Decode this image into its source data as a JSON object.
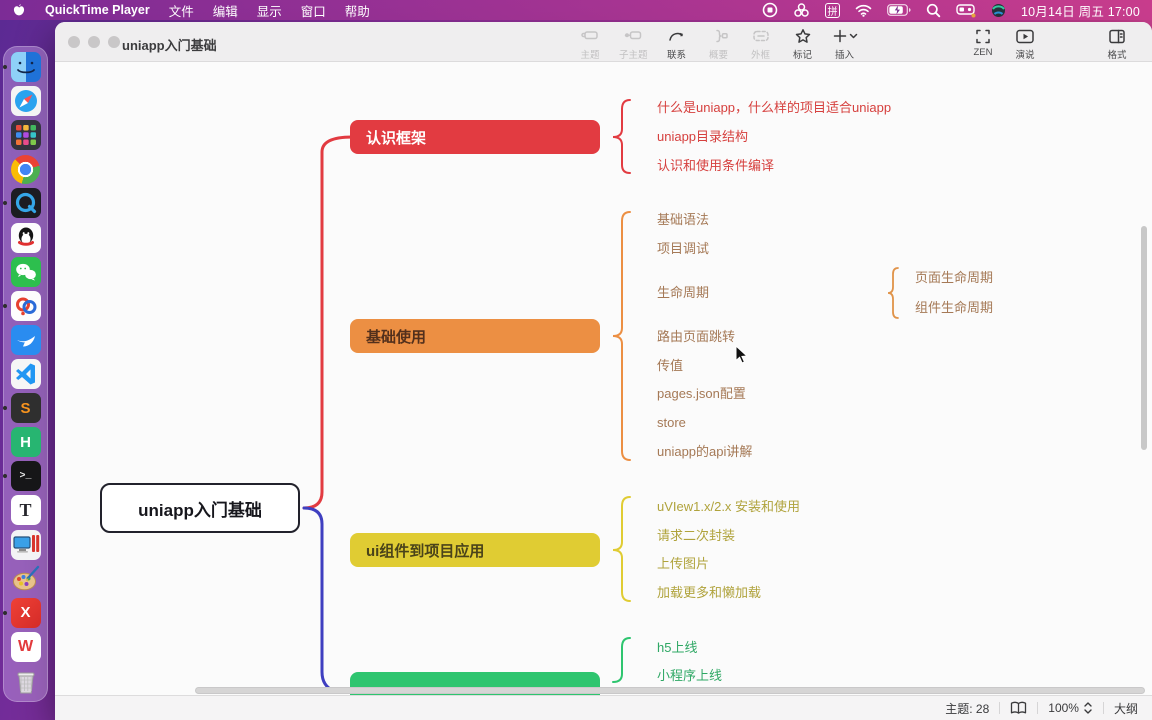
{
  "menu_bar": {
    "app_name": "QuickTime Player",
    "menus": [
      "文件",
      "编辑",
      "显示",
      "窗口",
      "帮助"
    ],
    "pinyin_glyph": "拼",
    "clock": "10月14日 周五 17:00",
    "status_icons": [
      "stop-recording",
      "screen-mirroring",
      "pinyin-input",
      "wifi",
      "battery-charging",
      "spotlight-search",
      "input-switcher",
      "app-sphere"
    ]
  },
  "dock": {
    "items": [
      "Finder",
      "Safari",
      "Launchpad",
      "Chrome",
      "QuickTime Player",
      "QQ",
      "WeChat",
      "Remote Loop App",
      "DingTalk",
      "VS Code",
      "Sublime Text",
      "HBuilderX",
      "Terminal",
      "Typora",
      "Screen Sharing",
      "Paint",
      "XMind",
      "WPS Office",
      "Trash"
    ],
    "running_indicators": [
      "Finder",
      "QuickTime Player",
      "Remote Loop App",
      "Sublime Text",
      "Terminal",
      "XMind"
    ],
    "letters": {
      "sublime": "S",
      "hbuilder": "H",
      "terminal": ">_",
      "typora": "T",
      "xmind": "X",
      "wps": "W"
    }
  },
  "window": {
    "title": "uniapp入门基础",
    "toolbar": {
      "items": [
        {
          "label": "主题",
          "enabled": false
        },
        {
          "label": "子主题",
          "enabled": false
        },
        {
          "label": "联系",
          "enabled": true
        },
        {
          "label": "概要",
          "enabled": false
        },
        {
          "label": "外框",
          "enabled": false
        },
        {
          "label": "标记",
          "enabled": true
        },
        {
          "label": "插入",
          "enabled": true
        }
      ],
      "right_items": [
        {
          "label": "ZEN"
        },
        {
          "label": "演说"
        },
        {
          "label": "格式"
        }
      ]
    },
    "status_bar": {
      "topics_label": "主题: 28",
      "zoom_value": "100%",
      "outline_label": "大纲"
    }
  },
  "mindmap": {
    "root_label": "uniapp入门基础",
    "colors": {
      "branch1": "#e23b41",
      "branch2": "#ec8f43",
      "branch3": "#e0cc33",
      "branch4": "#2ec56f",
      "root_link_top": "#e23b41",
      "root_link_bottom": "#3f3fc0"
    },
    "branches": [
      {
        "label": "认识框架",
        "children": [
          "什么是uniapp，什么样的项目适合uniapp",
          "uniapp目录结构",
          "认识和使用条件编译"
        ]
      },
      {
        "label": "基础使用",
        "children": [
          "基础语法",
          "项目调试",
          "生命周期",
          "路由页面跳转",
          "传值",
          "pages.json配置",
          "store",
          "uniapp的api讲解"
        ],
        "lifecycle_children": [
          "页面生命周期",
          "组件生命周期"
        ]
      },
      {
        "label": "ui组件到项目应用",
        "children": [
          "uVIew1.x/2.x 安装和使用",
          "请求二次封装",
          "上传图片",
          "加载更多和懒加载"
        ]
      },
      {
        "label": "",
        "children": [
          "h5上线",
          "小程序上线"
        ]
      }
    ]
  }
}
